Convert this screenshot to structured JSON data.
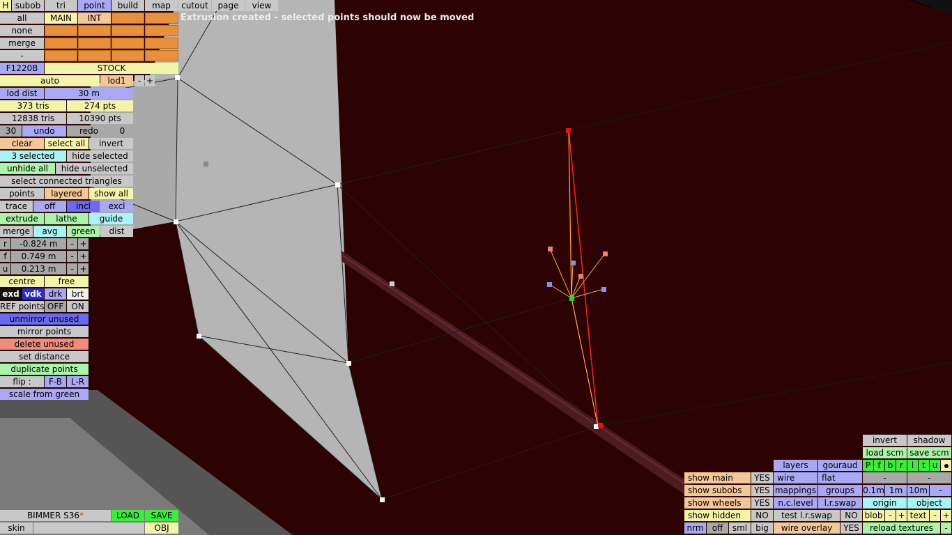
{
  "status_message": "Extrusion created - selected points should now be moved",
  "menu": {
    "h": "H",
    "tabs": [
      "subob",
      "tri",
      "point",
      "build",
      "map",
      "cutout",
      "page",
      "view"
    ],
    "active_tab": "point"
  },
  "layers": {
    "all": "all",
    "none": "none",
    "merge": "merge",
    "dash": "-",
    "main": "MAIN",
    "int": "INT"
  },
  "model": {
    "code": "F1220B",
    "variant": "STOCK",
    "lod_mode": "auto",
    "lod": "lod1",
    "minus": "-",
    "plus": "+"
  },
  "lod_dist": {
    "label": "lod dist",
    "value": "30 m"
  },
  "stats": {
    "tris": "373 tris",
    "pts": "274 pts",
    "total_tris": "12838 tris",
    "total_pts": "10390 pts"
  },
  "undo": {
    "count": "30",
    "undo": "undo",
    "redo": "redo",
    "redo_count": "0"
  },
  "selection": {
    "clear": "clear",
    "select_all": "select all",
    "invert": "invert",
    "count": "3 selected",
    "hide_selected": "hide selected",
    "unhide_all": "unhide all",
    "hide_unselected": "hide unselected",
    "select_connected": "select connected triangles"
  },
  "view_mode": {
    "points": "points",
    "layered": "layered",
    "show_all": "show all"
  },
  "trace": {
    "label": "trace",
    "off": "off",
    "incl": "incl",
    "excl": "excl"
  },
  "tools": {
    "extrude": "extrude",
    "lathe": "lathe",
    "guide": "guide",
    "merge": "merge",
    "avg": "avg",
    "green": "green",
    "dist": "dist"
  },
  "coords": [
    {
      "axis": "r",
      "value": "-0.824 m"
    },
    {
      "axis": "f",
      "value": "0.749 m"
    },
    {
      "axis": "u",
      "value": "0.213 m"
    }
  ],
  "pivot": {
    "centre": "centre",
    "free": "free"
  },
  "shade": {
    "exd": "exd",
    "vdk": "vdk",
    "drk": "drk",
    "brt": "brt"
  },
  "ref_points": {
    "label": "REF points",
    "off": "OFF",
    "on": "ON"
  },
  "actions": {
    "unmirror_unused": "unmirror unused",
    "mirror_points": "mirror points",
    "delete_unused": "delete unused",
    "set_distance": "set distance",
    "duplicate_points": "duplicate points",
    "flip": "flip :",
    "fb": "F-B",
    "lr": "L-R",
    "scale_from_green": "scale from green"
  },
  "file": {
    "name": "BIMMER S36",
    "modified_mark": "*",
    "load": "LOAD",
    "save": "SAVE",
    "skin": "skin",
    "format": "OBJ"
  },
  "right_panel": {
    "invert": "invert",
    "shadow": "shadow",
    "load_scm": "load scm",
    "save_scm": "save scm",
    "layers": "layers",
    "gouraud": "gouraud",
    "p_flags": [
      "P",
      "f",
      "b",
      "r",
      "l",
      "t",
      "u"
    ],
    "dash": "-",
    "wire": "wire",
    "flat": "flat",
    "mappings": "mappings",
    "groups": "groups",
    "step_01": "0.1m",
    "step_1": "1m",
    "step_10": "10m",
    "minus": "-",
    "plus": "+",
    "nc_level": "n.c.level",
    "lr_swap": "l.r.swap",
    "origin": "origin",
    "object": "object",
    "show_main": "show main",
    "show_main_value": "YES",
    "show_subobs": "show subobs",
    "show_subobs_value": "YES",
    "show_wheels": "show wheels",
    "show_wheels_value": "YES",
    "show_hidden": "show hidden",
    "show_hidden_value": "NO",
    "test_lr_swap": "test l.r.swap",
    "test_lr_swap_value": "NO",
    "blob": "blob",
    "text": "text",
    "nrm": "nrm",
    "off": "off",
    "sml": "sml",
    "big": "big",
    "wire_overlay": "wire overlay",
    "wire_overlay_value": "YES",
    "reload_textures": "reload textures"
  }
}
